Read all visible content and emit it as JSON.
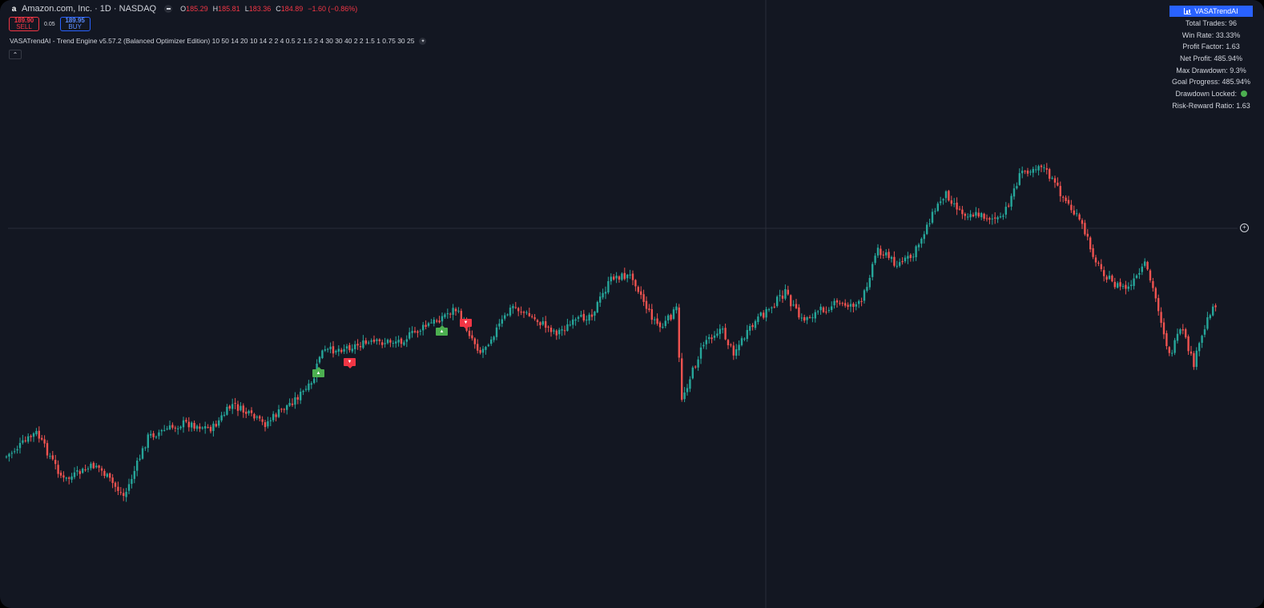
{
  "symbol": {
    "logo_icon": "amazon-logo-icon",
    "title": "Amazon.com, Inc. · 1D · NASDAQ",
    "open_label": "O",
    "open": "185.29",
    "high_label": "H",
    "high": "185.81",
    "low_label": "L",
    "low": "183.36",
    "close_label": "C",
    "close": "184.89",
    "change": "−1.60 (−0.86%)"
  },
  "trade": {
    "sell_price": "189.90",
    "sell_label": "SELL",
    "spread": "0.05",
    "buy_price": "189.95",
    "buy_label": "BUY"
  },
  "indicator": {
    "text": "VASATrendAI - Trend Engine v5.57.2 (Balanced Optimizer Edition) 10 50 14 20 10 14 2 2 4 0.5 2 1.5 2 4 30 30 40 2 2 1.5 1 0.75 30 25"
  },
  "stats": {
    "title": "VASATrendAI",
    "rows": [
      "Total Trades: 96",
      "Win Rate: 33.33%",
      "Profit Factor: 1.63",
      "Net Profit: 485.94%",
      "Max Drawdown: 9.3%",
      "Goal Progress: 485.94%",
      "Drawdown Locked:",
      "Risk-Reward Ratio: 1.63"
    ]
  },
  "colors": {
    "background": "#131722",
    "up": "#26a69a",
    "down": "#ef5350",
    "accent": "#2962ff",
    "text": "#d1d4dc"
  },
  "signals": [
    {
      "type": "buy",
      "label": "▲"
    },
    {
      "type": "sell",
      "label": "▼"
    },
    {
      "type": "buy",
      "label": "▲"
    },
    {
      "type": "sell",
      "label": "▼"
    }
  ]
}
